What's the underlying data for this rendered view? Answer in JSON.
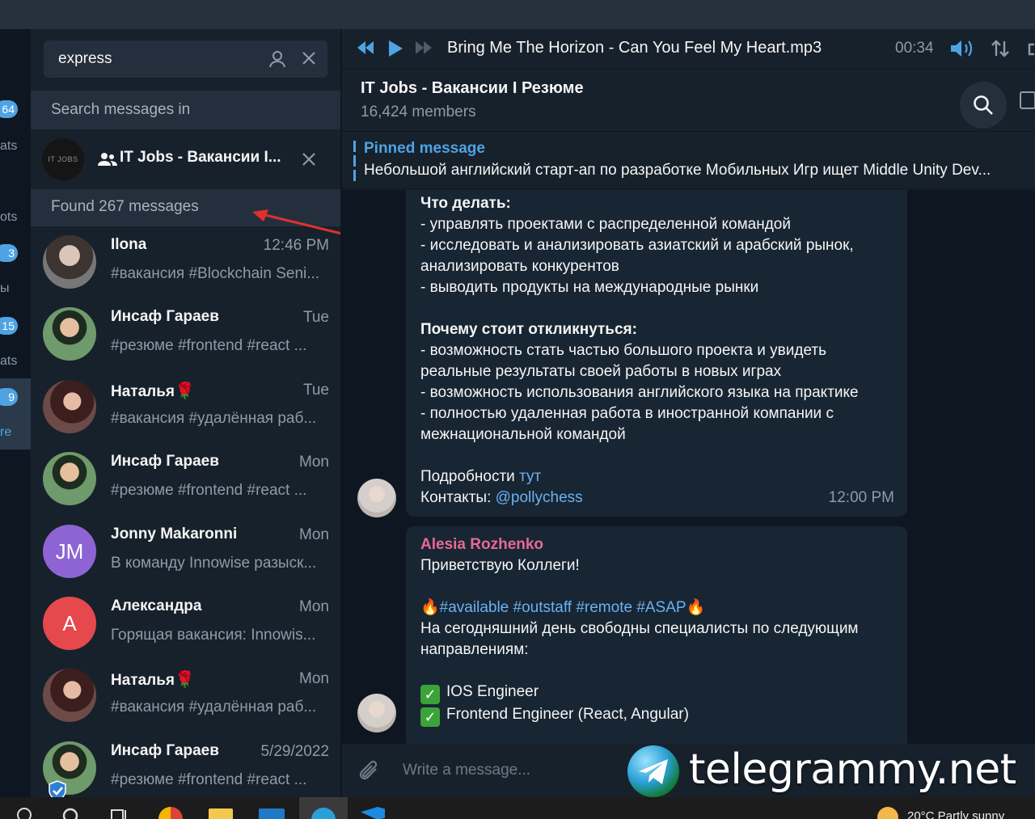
{
  "colors": {
    "accent": "#4fa3e3",
    "background": "#17212b",
    "bubble": "#182533",
    "sender": "#e56a92"
  },
  "folders": [
    {
      "badge": "64",
      "label": "ats"
    },
    {
      "badge": "",
      "label": "ots"
    },
    {
      "badge": "3",
      "label": "ы"
    },
    {
      "badge": "15",
      "label": "ats"
    },
    {
      "badge": "9",
      "label": "re"
    },
    {
      "badge": "",
      "label": ""
    }
  ],
  "search": {
    "value": "express",
    "icons": [
      "user-icon",
      "close-icon"
    ]
  },
  "search_in_label": "Search messages in",
  "chat_filter": {
    "avatar_text": "IT JOBS",
    "name": "IT Jobs - Вакансии I..."
  },
  "found_label": "Found 267 messages",
  "results": [
    {
      "name": "Ilona",
      "time": "12:46 PM",
      "preview": "#вакансия #Blockchain  Seni...",
      "avatar": "photo1",
      "initials": ""
    },
    {
      "name": "Инсаф Гараев",
      "time": "Tue",
      "preview": "#резюме #frontend #react ...",
      "avatar": "photo2",
      "initials": ""
    },
    {
      "name": "Наталья",
      "time": "Tue",
      "preview": "#вакансия #удалённая раб...",
      "avatar": "photo3",
      "initials": "",
      "emoji": "🌹"
    },
    {
      "name": "Инсаф Гараев",
      "time": "Mon",
      "preview": "#резюме #frontend #react ...",
      "avatar": "photo2",
      "initials": ""
    },
    {
      "name": "Jonny Makaronni",
      "time": "Mon",
      "preview": "В команду Innowise разыск...",
      "avatar": "#8e64d4",
      "initials": "JM"
    },
    {
      "name": "Александра",
      "time": "Mon",
      "preview": "Горящая вакансия: Innowis...",
      "avatar": "#e5484d",
      "initials": "A"
    },
    {
      "name": "Наталья",
      "time": "Mon",
      "preview": "#вакансия #удалённая раб...",
      "avatar": "photo3",
      "initials": "",
      "emoji": "🌹"
    },
    {
      "name": "Инсаф Гараев",
      "time": "5/29/2022",
      "preview": "#резюме #frontend #react ...",
      "avatar": "photo2",
      "initials": ""
    }
  ],
  "player": {
    "track": "Bring Me The Horizon - Can You Feel My Heart.mp3",
    "time": "00:34"
  },
  "chat": {
    "title": "IT Jobs - Вакансии I Резюме",
    "members": "16,424 members"
  },
  "pinned": {
    "title": "Pinned message",
    "text": "Небольшой английский старт-ап по разработке Мобильных Игр ищет Middle Unity Dev..."
  },
  "message1": {
    "h1": "Что делать:",
    "lines1": [
      "- управлять проектами с распределенной командой",
      "- исследовать и анализировать азиатский и арабский рынок, анализировать конкурентов",
      "- выводить продукты на международные рынки"
    ],
    "h2": "Почему стоит откликнуться:",
    "lines2": [
      "- возможность стать частью большого проекта и увидеть реальные результаты своей работы в новых играх",
      "- возможность использования английского языка на практике",
      "- полностью удаленная работа в иностранной компании с межнациональной командой"
    ],
    "details_label": "Подробности",
    "details_link": "тут",
    "contacts_label": "Контакты:",
    "contacts_link": "@pollychess",
    "time": "12:00 PM"
  },
  "message2": {
    "sender": "Alesia Rozhenko",
    "greeting": "Приветствую Коллеги!",
    "tags": "#available #outstaff #remote #ASAP",
    "fire": "🔥",
    "intro": "На сегодняшний день свободны специалисты по следующим направлениям:",
    "items": [
      "IOS Engineer",
      "Frontend Engineer (React, Angular)"
    ],
    "check": "✓"
  },
  "composer": {
    "placeholder": "Write a message..."
  },
  "watermark": "telegrammy.net",
  "taskbar": {
    "weather": "20°C  Partly sunny"
  }
}
